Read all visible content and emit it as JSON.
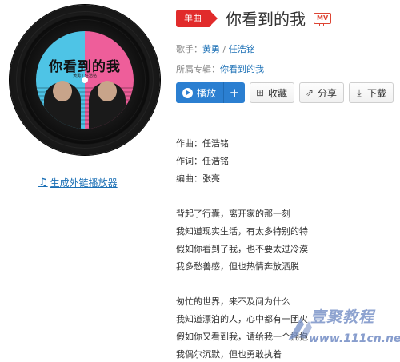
{
  "album_art": {
    "cover_title": "你看到的我",
    "cover_sub": "黄勇 / 任浩铭"
  },
  "external_player_link": {
    "icon": "music-note-icon",
    "label": "生成外链播放器"
  },
  "song": {
    "badge": "单曲",
    "title": "你看到的我",
    "mv_label": "MV"
  },
  "singer": {
    "label": "歌手：",
    "artists": [
      "黄勇",
      "任浩铭"
    ],
    "separator": " / "
  },
  "album": {
    "label": "所属专辑：",
    "name": "你看到的我"
  },
  "actions": {
    "play": "播放",
    "add": "+",
    "collect": "收藏",
    "share": "分享",
    "download": "下载"
  },
  "lyrics": [
    "作曲：任浩铭",
    "作词：任浩铭",
    "编曲：张亮",
    "",
    "背起了行囊，离开家的那一刻",
    "我知道现实生活，有太多特别的特",
    "假如你看到了我，也不要太过冷漠",
    "我多愁善感，但也热情奔放洒脱",
    "",
    "匆忙的世界，来不及问为什么",
    "我知道漂泊的人，心中都有一团火",
    "假如你又看到我，请给我一个拥抱",
    "我偶尔沉默，但也勇敢执着"
  ],
  "watermark": {
    "brand": "壹聚教程",
    "url": "www.111cn.net"
  },
  "colors": {
    "accent_blue": "#2b7fd1",
    "badge_red": "#e12b2b",
    "link_blue": "#1a6fb5"
  }
}
